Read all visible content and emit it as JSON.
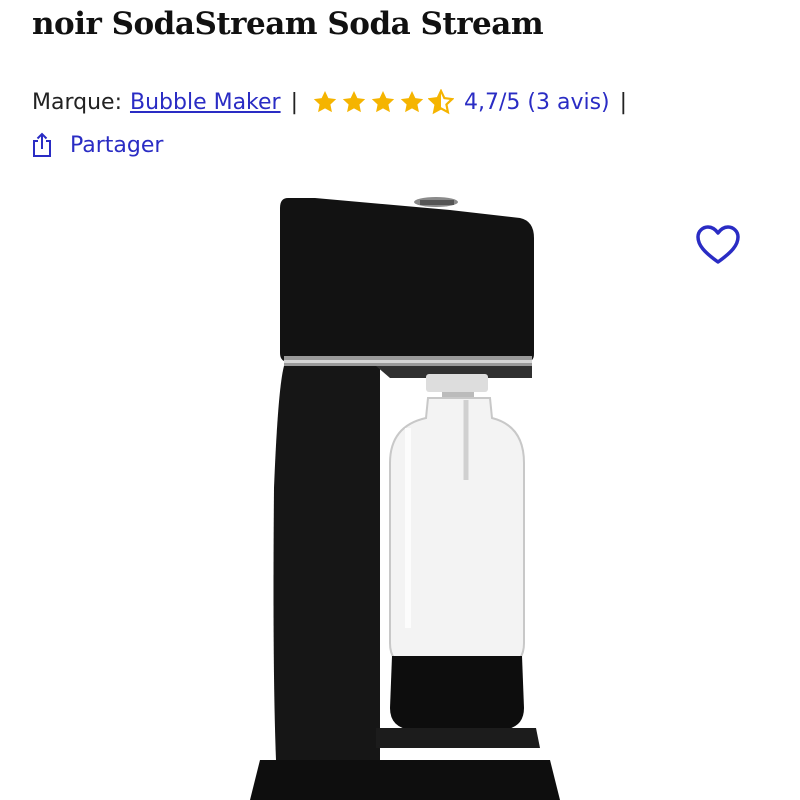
{
  "product": {
    "title": "noir SodaStream Soda Stream",
    "brand_label": "Marque:",
    "brand_name": "Bubble Maker",
    "separator": "|",
    "rating": 4.7,
    "rating_text": "4,7/5 (3 avis)",
    "stars_max": 5
  },
  "actions": {
    "share_label": "Partager"
  },
  "icons": {
    "share": "share-icon",
    "favorite": "heart-outline-icon",
    "star": "star-icon"
  },
  "colors": {
    "link": "#2a2cc4",
    "star": "#f5b400",
    "text": "#1a1a1a"
  }
}
